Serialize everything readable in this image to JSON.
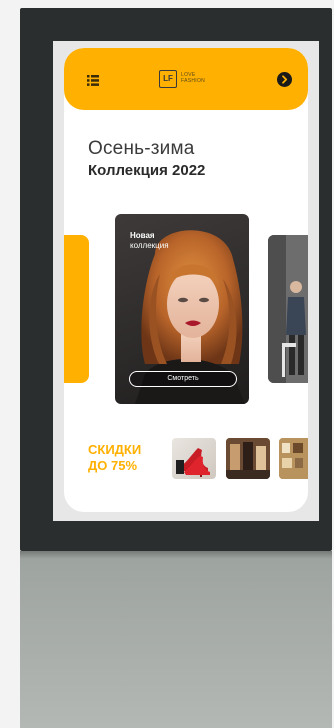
{
  "header": {
    "logo_mark": "LF",
    "logo_text": "LOVE FASHION"
  },
  "hero": {
    "title_light": "Осень-зима",
    "title_bold": "Коллекция 2022"
  },
  "carousel": {
    "slide_label_bold": "Новая",
    "slide_label_rest": "коллекция",
    "button_label": "Смотреть"
  },
  "sale": {
    "line1": "СКИДКИ",
    "line2": "ДО 75%"
  },
  "colors": {
    "accent": "#ffb000",
    "kiosk_frame": "#2b2e2f",
    "screen_bg": "#ffffff",
    "title_text": "#2b2b2b"
  },
  "icons": {
    "menu": "list-menu-icon",
    "next": "arrow-right-circle-icon"
  }
}
